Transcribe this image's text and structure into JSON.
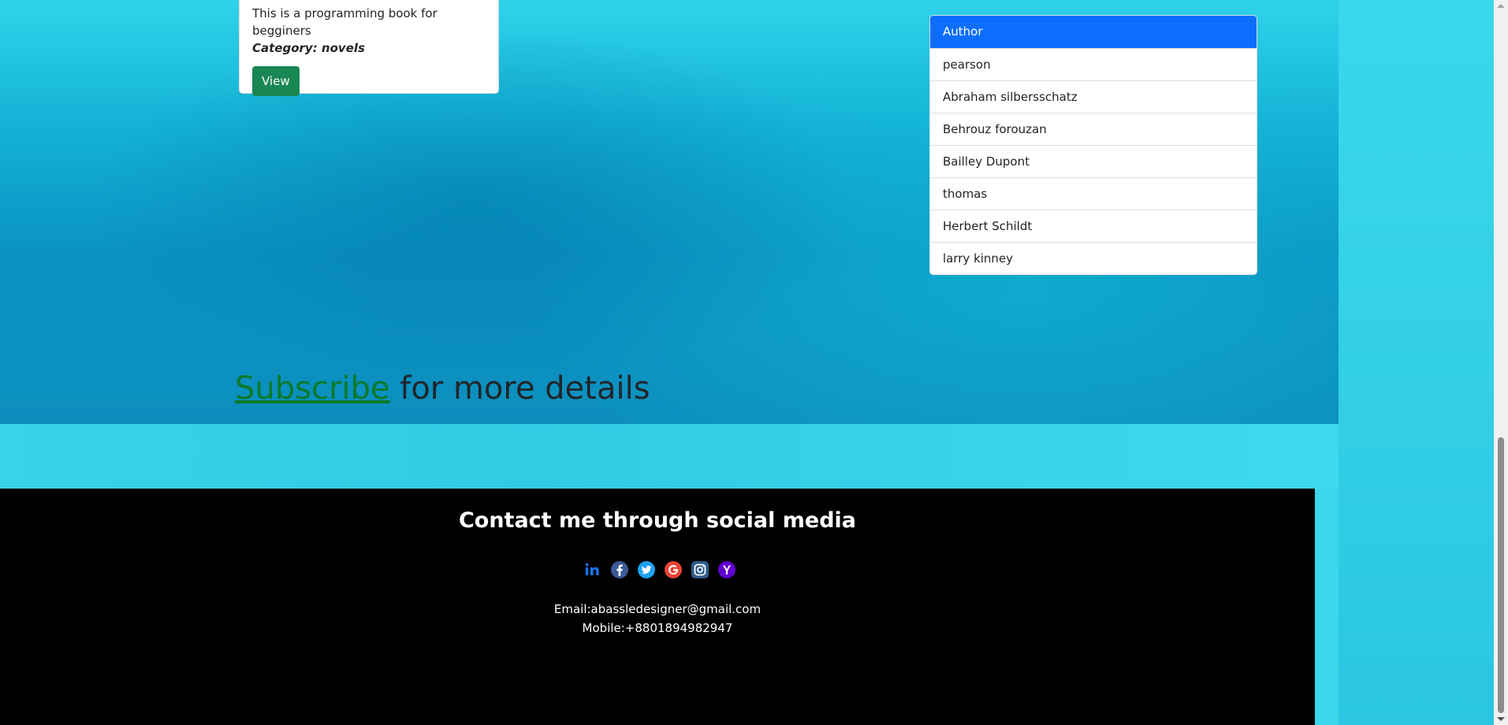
{
  "book_card": {
    "description": "This is a programming book for begginers",
    "category": "Category: novels",
    "view_label": "View"
  },
  "author_list": {
    "heading": "Author",
    "items": [
      "pearson",
      "Abraham silbersschatz",
      "Behrouz forouzan",
      "Bailley Dupont",
      "thomas",
      "Herbert Schildt",
      "larry kinney"
    ]
  },
  "subscribe": {
    "link_text": "Subscribe",
    "rest_text": " for more details"
  },
  "footer": {
    "title": "Contact me through social media",
    "social_icons": [
      "linkedin-icon",
      "facebook-icon",
      "twitter-icon",
      "google-icon",
      "instagram-icon",
      "yahoo-icon"
    ],
    "email": "Email:abassledesigner@gmail.com",
    "mobile": "Mobile:+8801894982947"
  },
  "colors": {
    "primary": "#0d6efd",
    "success": "#198754",
    "link_green": "#0a7a2a",
    "footer_bg": "#000000"
  }
}
